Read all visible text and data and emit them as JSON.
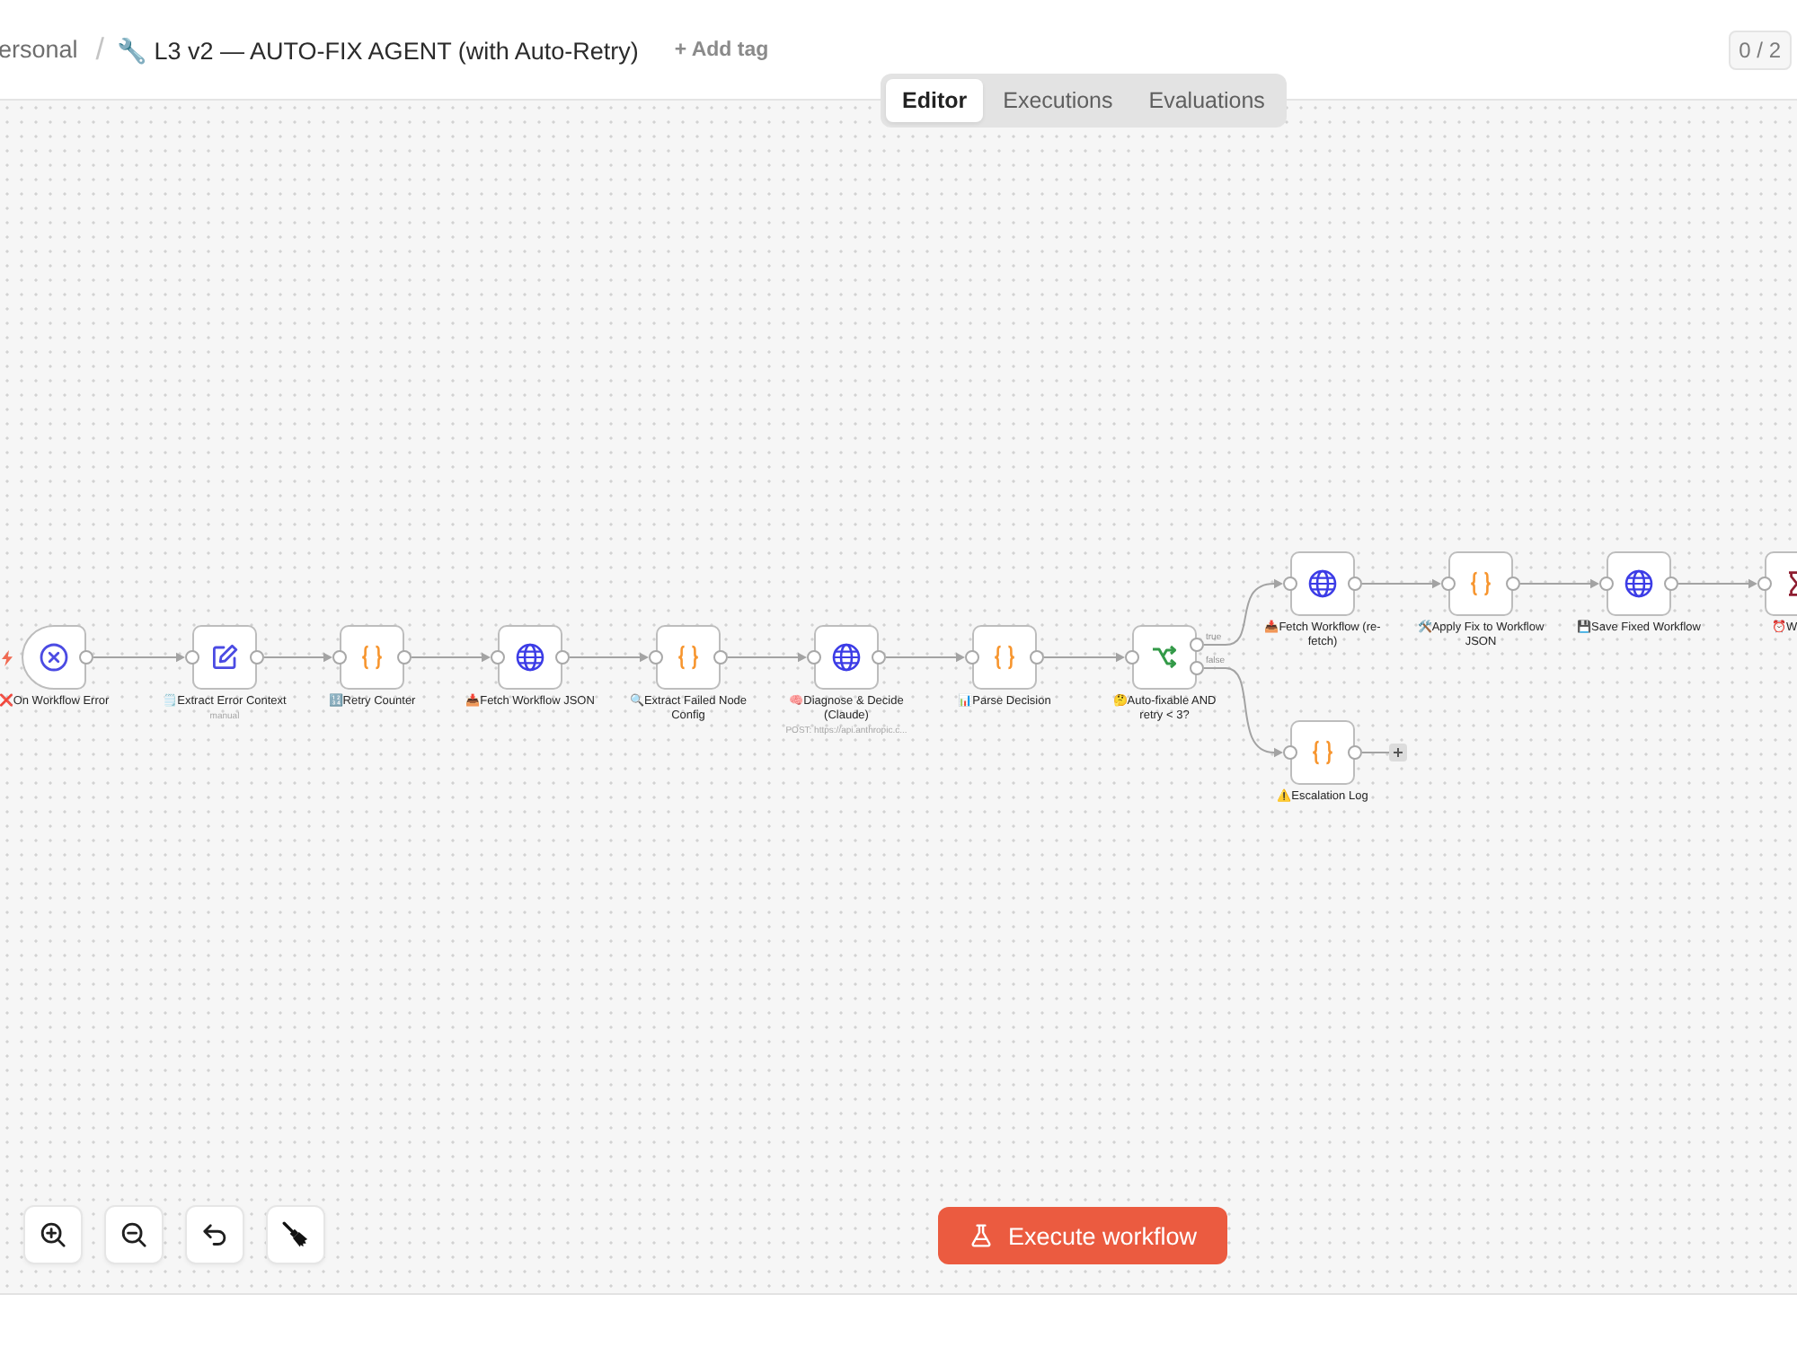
{
  "header": {
    "breadcrumb": "ersonal",
    "separator": "/",
    "title": "🔧 L3 v2 — AUTO-FIX AGENT (with Auto-Retry)",
    "add_tag": "+ Add tag",
    "counter": "0 / 2"
  },
  "view_tabs": [
    {
      "label": "Editor",
      "selected": true
    },
    {
      "label": "Executions",
      "selected": false
    },
    {
      "label": "Evaluations",
      "selected": false
    }
  ],
  "canvas": {
    "nodes": [
      {
        "label": "❌On Workflow Error",
        "kind": "trigger",
        "end_stub": false
      },
      {
        "label": "🗒️Extract Error Context",
        "subtitle": "manual",
        "kind": "set",
        "end_stub": false
      },
      {
        "label": "🔢Retry Counter",
        "kind": "code",
        "end_stub": false
      },
      {
        "label": "📥Fetch Workflow JSON",
        "kind": "http",
        "end_stub": false
      },
      {
        "label": "🔍Extract Failed Node Config",
        "kind": "code",
        "end_stub": false
      },
      {
        "label": "🧠Diagnose & Decide (Claude)",
        "subtitle": "POST: https://api.anthropic.c...",
        "kind": "http",
        "end_stub": false
      },
      {
        "label": "📊Parse Decision",
        "kind": "code",
        "end_stub": false
      },
      {
        "label": "🤔Auto-fixable AND retry < 3?",
        "kind": "if",
        "outputs": [
          "true",
          "false"
        ],
        "end_stub": false
      },
      {
        "label": "📥Fetch Workflow (re-fetch)",
        "kind": "http",
        "end_stub": false
      },
      {
        "label": "🛠️Apply Fix to Workflow JSON",
        "kind": "code",
        "end_stub": false
      },
      {
        "label": "💾Save Fixed Workflow",
        "kind": "http",
        "end_stub": false
      },
      {
        "label": "⏰W",
        "kind": "wait",
        "end_stub": false
      },
      {
        "label": "⚠️Escalation Log",
        "kind": "code",
        "end_stub": true
      }
    ]
  },
  "execute_button": {
    "label": "Execute workflow"
  }
}
